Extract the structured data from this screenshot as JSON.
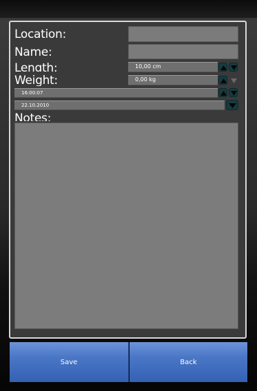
{
  "form": {
    "location_label": "Location:",
    "location_value": "",
    "name_label": "Name:",
    "name_value": "",
    "length_label": "Length:",
    "length_value": "10,00 cm",
    "weight_label": "Weight:",
    "weight_value": "0,00 kg",
    "time_value": "16:00:07",
    "date_value": "22.10.2010",
    "notes_label": "Notes:",
    "notes_value": ""
  },
  "buttons": {
    "save_label": "Save",
    "back_label": "Back"
  },
  "icons": {
    "up": "arrow-up-icon",
    "down": "arrow-down-icon",
    "date_dropdown": "chevron-down-icon"
  },
  "colors": {
    "accent_button": "#4a76c6",
    "panel_border": "#d9d9d9",
    "spin_button": "#173a3f"
  }
}
